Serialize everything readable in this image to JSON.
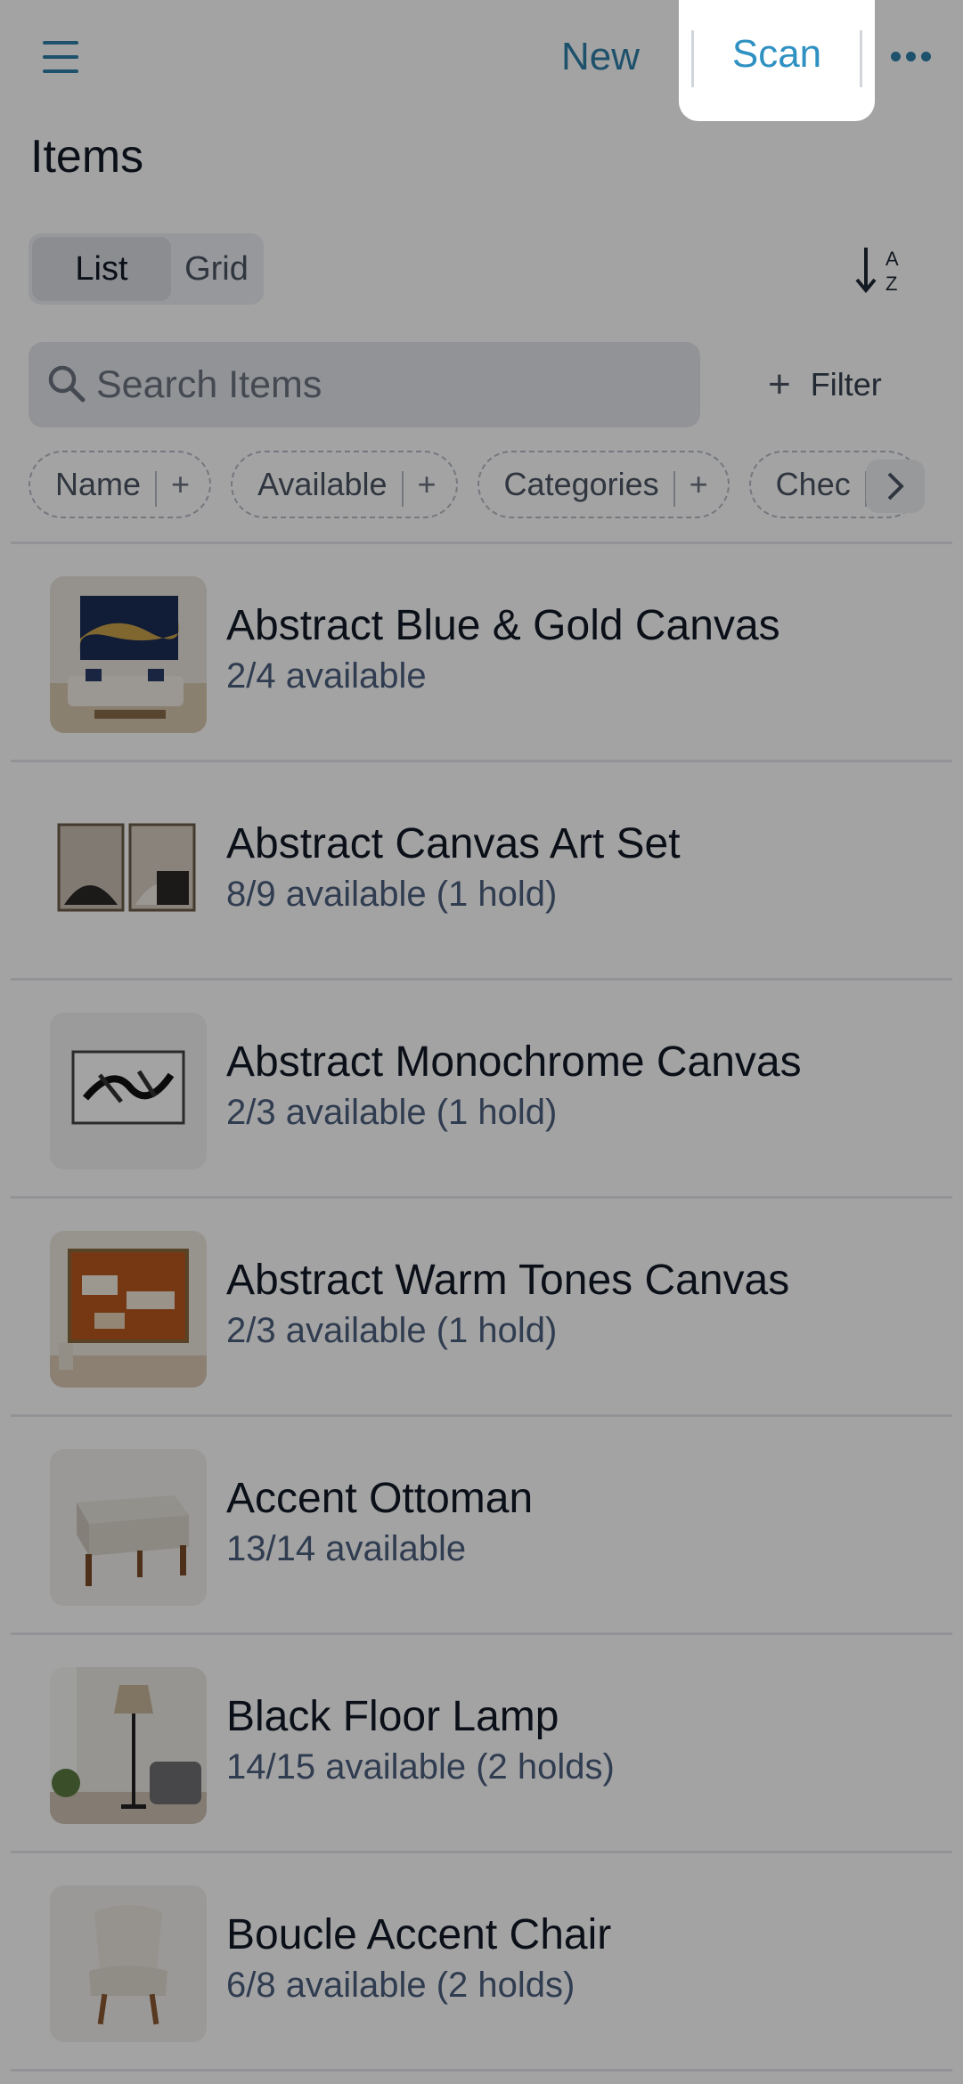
{
  "header": {
    "new_label": "New",
    "scan_label": "Scan"
  },
  "page": {
    "title": "Items"
  },
  "view_toggle": {
    "list_label": "List",
    "grid_label": "Grid",
    "selected": "List"
  },
  "search": {
    "placeholder": "Search Items",
    "value": ""
  },
  "filter": {
    "label": "Filter"
  },
  "chips": [
    {
      "label": "Name"
    },
    {
      "label": "Available"
    },
    {
      "label": "Categories"
    },
    {
      "label": "Chec"
    }
  ],
  "items": [
    {
      "name": "Abstract Blue & Gold Canvas",
      "availability": "2/4 available"
    },
    {
      "name": "Abstract Canvas Art Set",
      "availability": "8/9 available (1 hold)"
    },
    {
      "name": "Abstract Monochrome Canvas",
      "availability": "2/3 available (1 hold)"
    },
    {
      "name": "Abstract Warm Tones Canvas",
      "availability": "2/3 available (1 hold)"
    },
    {
      "name": "Accent Ottoman",
      "availability": "13/14 available"
    },
    {
      "name": "Black Floor Lamp",
      "availability": "14/15 available (2 holds)"
    },
    {
      "name": "Boucle Accent Chair",
      "availability": "6/8 available (2 holds)"
    }
  ],
  "colors": {
    "accent": "#2f7fa8",
    "scan_accent": "#2f91c2",
    "subtext": "#4b5e7e",
    "dim_overlay": "rgba(0,0,0,0.36)"
  },
  "icons": {
    "menu": "hamburger-menu-icon",
    "more": "more-horizontal-icon",
    "sort": "sort-alpha-icon",
    "search": "search-icon",
    "filter": "plus-icon",
    "chips_next": "chevron-right-icon"
  }
}
